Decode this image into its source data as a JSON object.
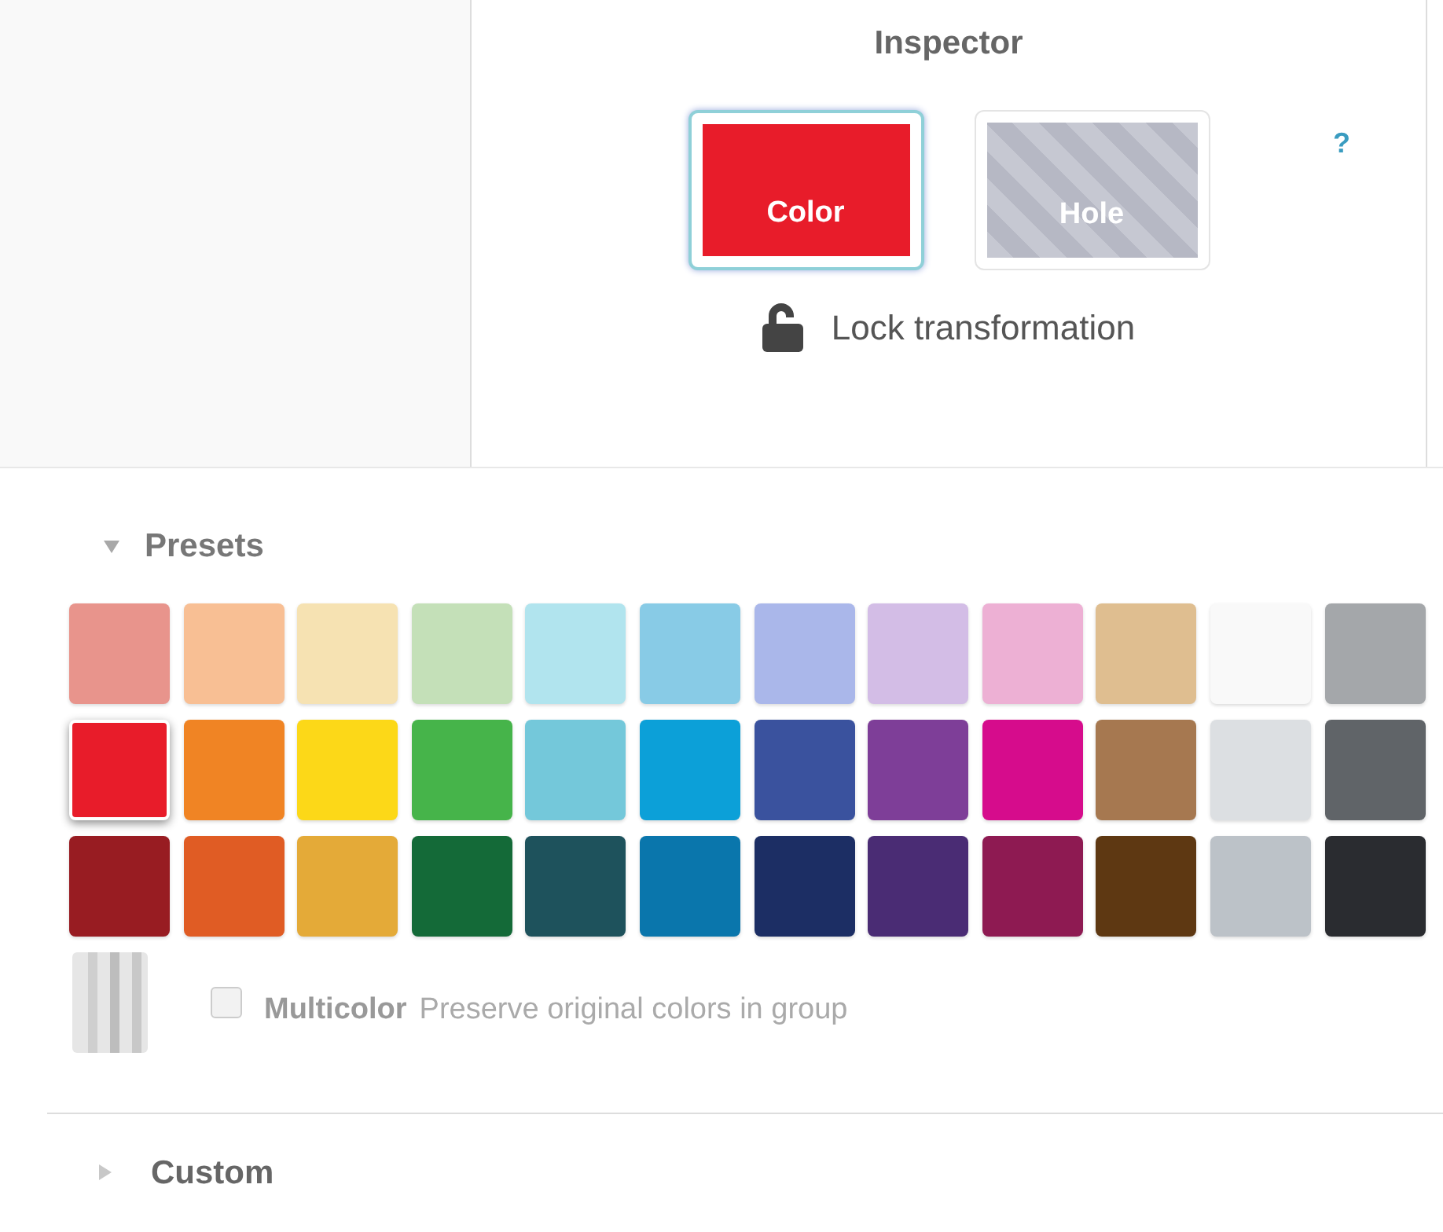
{
  "inspector": {
    "title": "Inspector",
    "help": "?",
    "modes": [
      {
        "label": "Color",
        "kind": "color",
        "selected": true
      },
      {
        "label": "Hole",
        "kind": "hole",
        "selected": false
      }
    ],
    "lock": {
      "label": "Lock transformation"
    }
  },
  "presets": {
    "title": "Presets",
    "expanded": true,
    "swatches": [
      {
        "color": "#e8948c",
        "selected": false
      },
      {
        "color": "#f8bf94",
        "selected": false
      },
      {
        "color": "#f6e2b2",
        "selected": false
      },
      {
        "color": "#c4e0b8",
        "selected": false
      },
      {
        "color": "#b1e4ee",
        "selected": false
      },
      {
        "color": "#88cbe6",
        "selected": false
      },
      {
        "color": "#aab7ea",
        "selected": false
      },
      {
        "color": "#d3bde6",
        "selected": false
      },
      {
        "color": "#edb0d4",
        "selected": false
      },
      {
        "color": "#dfbe90",
        "selected": false
      },
      {
        "color": "#f9f9f9",
        "selected": false
      },
      {
        "color": "#a4a7aa",
        "selected": false
      },
      {
        "color": "#e81c2a",
        "selected": true
      },
      {
        "color": "#f08424",
        "selected": false
      },
      {
        "color": "#fcd818",
        "selected": false
      },
      {
        "color": "#46b44a",
        "selected": false
      },
      {
        "color": "#74c8da",
        "selected": false
      },
      {
        "color": "#0ca0d8",
        "selected": false
      },
      {
        "color": "#3a529e",
        "selected": false
      },
      {
        "color": "#7e3e98",
        "selected": false
      },
      {
        "color": "#d60c8c",
        "selected": false
      },
      {
        "color": "#a67850",
        "selected": false
      },
      {
        "color": "#dcdfe2",
        "selected": false
      },
      {
        "color": "#606468",
        "selected": false
      },
      {
        "color": "#981c22",
        "selected": false
      },
      {
        "color": "#e05c24",
        "selected": false
      },
      {
        "color": "#e4aa38",
        "selected": false
      },
      {
        "color": "#146a38",
        "selected": false
      },
      {
        "color": "#1e525c",
        "selected": false
      },
      {
        "color": "#0a76ac",
        "selected": false
      },
      {
        "color": "#1c2e64",
        "selected": false
      },
      {
        "color": "#4a2c74",
        "selected": false
      },
      {
        "color": "#8e1a52",
        "selected": false
      },
      {
        "color": "#5e3812",
        "selected": false
      },
      {
        "color": "#bcc2c8",
        "selected": false
      },
      {
        "color": "#2a2c30",
        "selected": false
      }
    ],
    "multicolor": {
      "label": "Multicolor",
      "description": "Preserve original colors in group",
      "checked": false
    }
  },
  "custom": {
    "title": "Custom",
    "expanded": false
  }
}
